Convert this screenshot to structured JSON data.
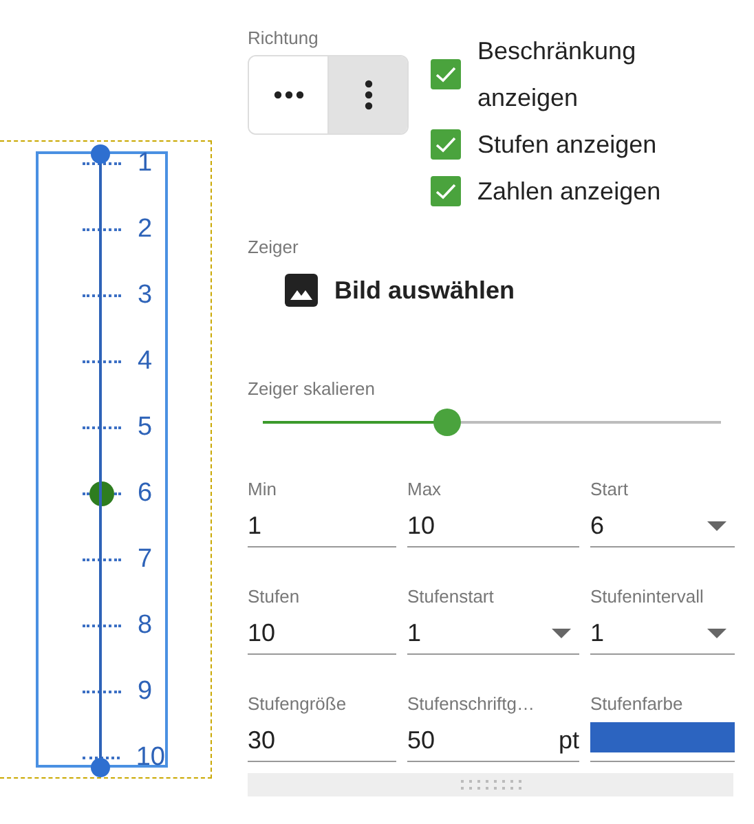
{
  "preview": {
    "ticks": [
      {
        "label": "1",
        "selected": false
      },
      {
        "label": "2",
        "selected": false
      },
      {
        "label": "3",
        "selected": false
      },
      {
        "label": "4",
        "selected": false
      },
      {
        "label": "5",
        "selected": false
      },
      {
        "label": "6",
        "selected": true
      },
      {
        "label": "7",
        "selected": false
      },
      {
        "label": "8",
        "selected": false
      },
      {
        "label": "9",
        "selected": false
      },
      {
        "label": "10",
        "selected": false
      }
    ]
  },
  "direction": {
    "label": "Richtung",
    "options": [
      {
        "kind": "horizontal",
        "selected": false
      },
      {
        "kind": "vertical",
        "selected": true
      }
    ]
  },
  "checkboxes": [
    {
      "label": "Beschränkung anzeigen",
      "checked": true
    },
    {
      "label": "Stufen anzeigen",
      "checked": true
    },
    {
      "label": "Zahlen anzeigen",
      "checked": true
    }
  ],
  "pointer": {
    "label": "Zeiger",
    "button": "Bild auswählen"
  },
  "scale": {
    "label": "Zeiger skalieren",
    "level": 0.38
  },
  "fields": [
    {
      "kind": "text",
      "label": "Min",
      "value": "1"
    },
    {
      "kind": "text",
      "label": "Max",
      "value": "10"
    },
    {
      "kind": "dropdown",
      "label": "Start",
      "value": "6"
    },
    {
      "kind": "text",
      "label": "Stufen",
      "value": "10"
    },
    {
      "kind": "dropdown",
      "label": "Stufenstart",
      "value": "1"
    },
    {
      "kind": "dropdown",
      "label": "Stufenintervall",
      "value": "1"
    },
    {
      "kind": "text",
      "label": "Stufengröße",
      "value": "30"
    },
    {
      "kind": "unit",
      "label": "Stufenschriftg…",
      "value": "50",
      "unit": "pt"
    },
    {
      "kind": "color",
      "label": "Stufenfarbe",
      "color": "#2c64c0"
    }
  ]
}
